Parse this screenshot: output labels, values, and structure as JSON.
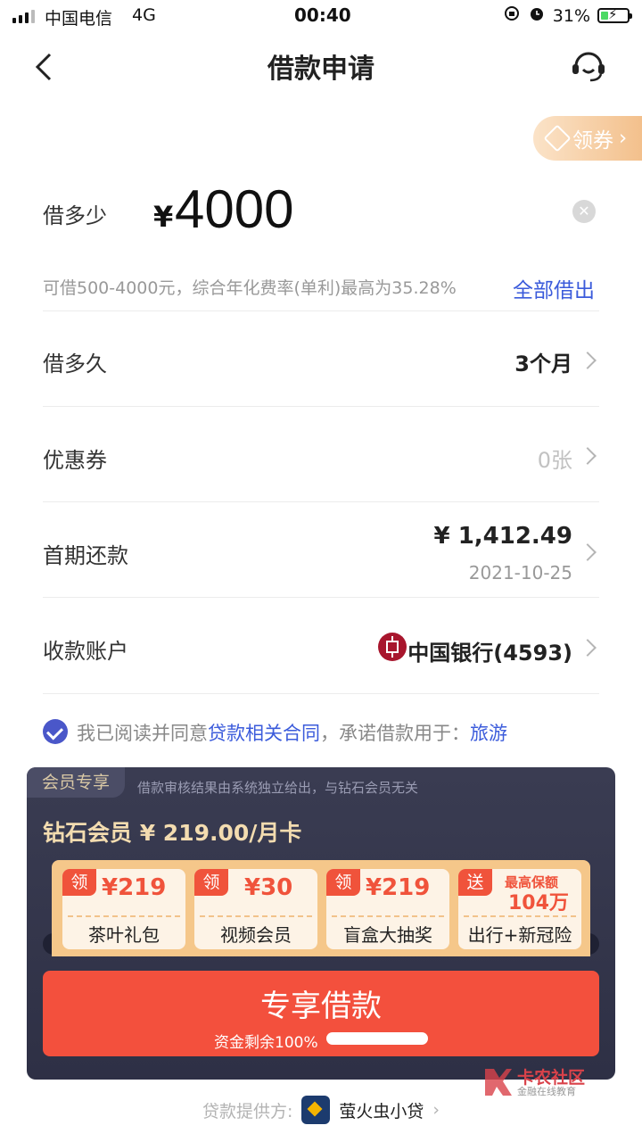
{
  "status_bar": {
    "carrier": "中国电信",
    "network": "4G",
    "time": "00:40",
    "battery": "31%"
  },
  "header": {
    "title": "借款申请"
  },
  "coupon_tab": {
    "label": "领券"
  },
  "amount": {
    "label": "借多少",
    "currency": "¥",
    "value": "4000",
    "hint": "可借500-4000元，综合年化费率(单利)最高为35.28%",
    "borrow_all": "全部借出"
  },
  "rows": {
    "term": {
      "label": "借多久",
      "value": "3个月"
    },
    "coupon": {
      "label": "优惠券",
      "value": "0张"
    },
    "first_payment": {
      "label": "首期还款",
      "value": "¥ 1,412.49",
      "date": "2021-10-25"
    },
    "account": {
      "label": "收款账户",
      "value": "中国银行(4593)"
    }
  },
  "agreement": {
    "prefix": "我已阅读并同意",
    "link": "贷款相关合同",
    "middle": "，承诺借款用于：",
    "purpose": "旅游"
  },
  "member": {
    "tag": "会员专享",
    "note": "借款审核结果由系统独立给出，与钻石会员无关",
    "title": "钻石会员  ¥ 219.00/月卡",
    "benefits": [
      {
        "badge": "领",
        "price": "¥219",
        "name": "茶叶礼包"
      },
      {
        "badge": "领",
        "price": "¥30",
        "name": "视频会员"
      },
      {
        "badge": "领",
        "price": "¥219",
        "name": "盲盒大抽奖"
      },
      {
        "badge": "送",
        "line1": "最高保额",
        "line2": "104万",
        "name": "出行+新冠险"
      }
    ]
  },
  "cta": {
    "label": "专享借款",
    "sub": "资金剩余100%",
    "remaining_fraction": 1.0
  },
  "watermark": {
    "title": "卡农社区",
    "sub": "金融在线教育"
  },
  "provider": {
    "label": "贷款提供方:",
    "name": "萤火虫小贷"
  },
  "colors": {
    "accent_blue": "#3b5bdb",
    "cta_red": "#f3503d",
    "gold": "#f3dcb0",
    "card_dark": "#2e3045"
  }
}
